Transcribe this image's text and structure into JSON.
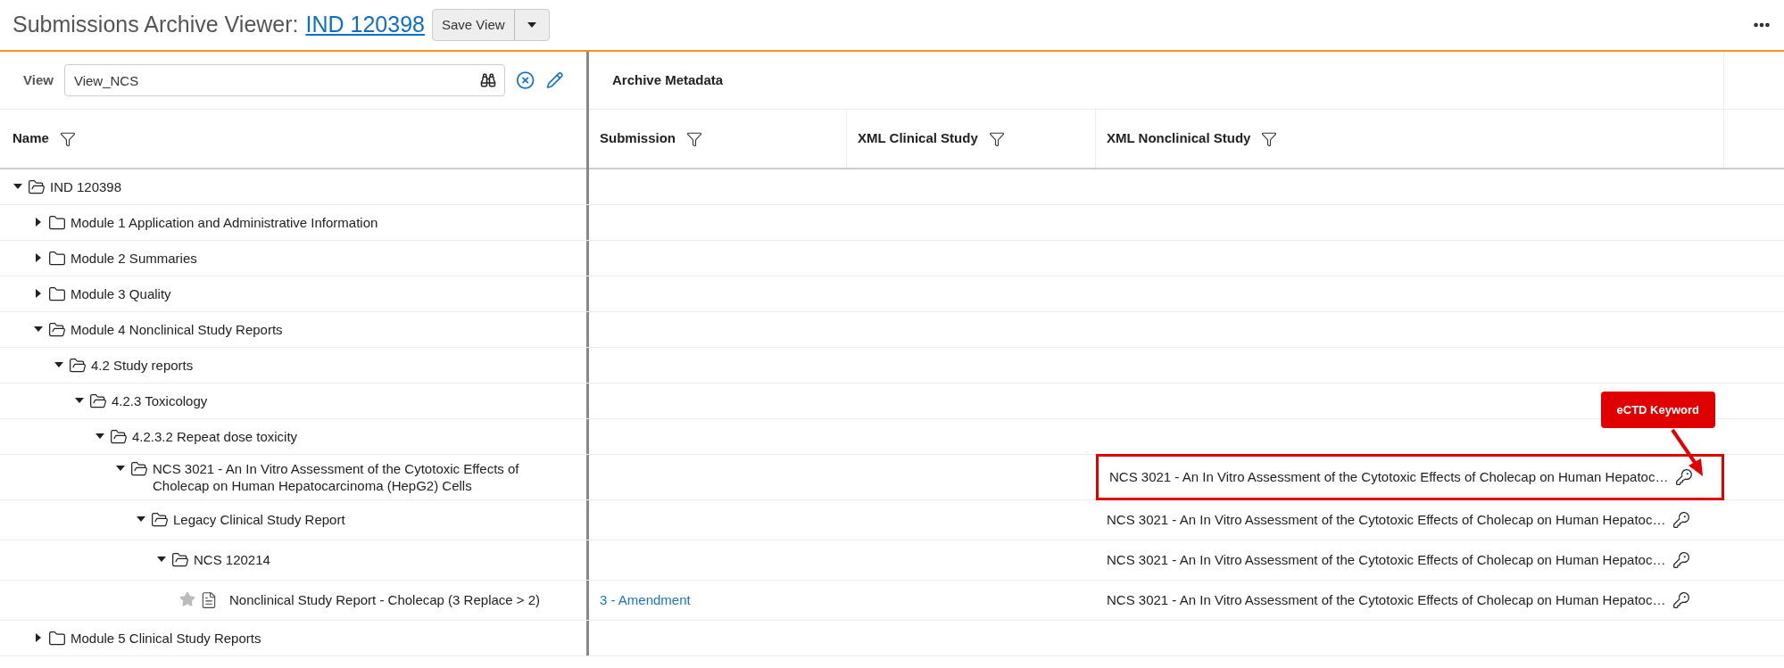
{
  "header": {
    "title": "Submissions Archive Viewer:",
    "link": "IND 120398",
    "save_button": "Save View"
  },
  "view": {
    "label": "View",
    "value": "View_NCS"
  },
  "metadata_title": "Archive Metadata",
  "columns": [
    "Name",
    "Submission",
    "XML Clinical Study",
    "XML Nonclinical Study"
  ],
  "annotation": {
    "label": "eCTD Keyword"
  },
  "tree": [
    {
      "name": "IND 120398",
      "kind": "folder",
      "expanded": true,
      "highlighted": false,
      "children": [
        {
          "name": "Module 1 Application and Administrative Information",
          "kind": "folder",
          "expanded": false,
          "highlighted": false
        },
        {
          "name": "Module 2 Summaries",
          "kind": "folder",
          "expanded": false,
          "highlighted": false
        },
        {
          "name": "Module 3 Quality",
          "kind": "folder",
          "expanded": false,
          "highlighted": false
        },
        {
          "name": "Module 4 Nonclinical Study Reports",
          "kind": "folder",
          "expanded": true,
          "highlighted": false,
          "children": [
            {
              "name": "4.2 Study reports",
              "kind": "folder",
              "expanded": true,
              "highlighted": false,
              "children": [
                {
                  "name": "4.2.3 Toxicology",
                  "kind": "folder",
                  "expanded": true,
                  "highlighted": false,
                  "children": [
                    {
                      "name": "4.2.3.2 Repeat dose toxicity",
                      "kind": "folder",
                      "expanded": true,
                      "highlighted": false,
                      "children": [
                        {
                          "name": "NCS 3021 - An In Vitro Assessment of the Cytotoxic Effects of Cholecap on Human Hepatocarcinoma (HepG2) Cells",
                          "kind": "folder",
                          "expanded": true,
                          "highlighted": true,
                          "nonclinical_study": "NCS 3021 - An In Vitro Assessment of the Cytotoxic Effects of Cholecap on Human Hepatoc…",
                          "children": [
                            {
                              "name": "Legacy Clinical Study Report",
                              "kind": "folder",
                              "expanded": true,
                              "highlighted": false,
                              "nonclinical_study": "NCS 3021 - An In Vitro Assessment of the Cytotoxic Effects of Cholecap on Human Hepatoc…",
                              "children": [
                                {
                                  "name": "NCS 120214",
                                  "kind": "folder",
                                  "expanded": true,
                                  "highlighted": false,
                                  "nonclinical_study": "NCS 3021 - An In Vitro Assessment of the Cytotoxic Effects of Cholecap on Human Hepatoc…",
                                  "children": [
                                    {
                                      "name": "Nonclinical Study Report - Cholecap (3 Replace > 2)",
                                      "kind": "document",
                                      "highlighted": false,
                                      "submission": "3 - Amendment",
                                      "nonclinical_study": "NCS 3021 - An In Vitro Assessment of the Cytotoxic Effects of Cholecap on Human Hepatoc…"
                                    }
                                  ]
                                }
                              ]
                            }
                          ]
                        }
                      ]
                    }
                  ]
                }
              ]
            }
          ]
        },
        {
          "name": "Module 5 Clinical Study Reports",
          "kind": "folder",
          "expanded": false,
          "highlighted": false
        }
      ]
    }
  ]
}
